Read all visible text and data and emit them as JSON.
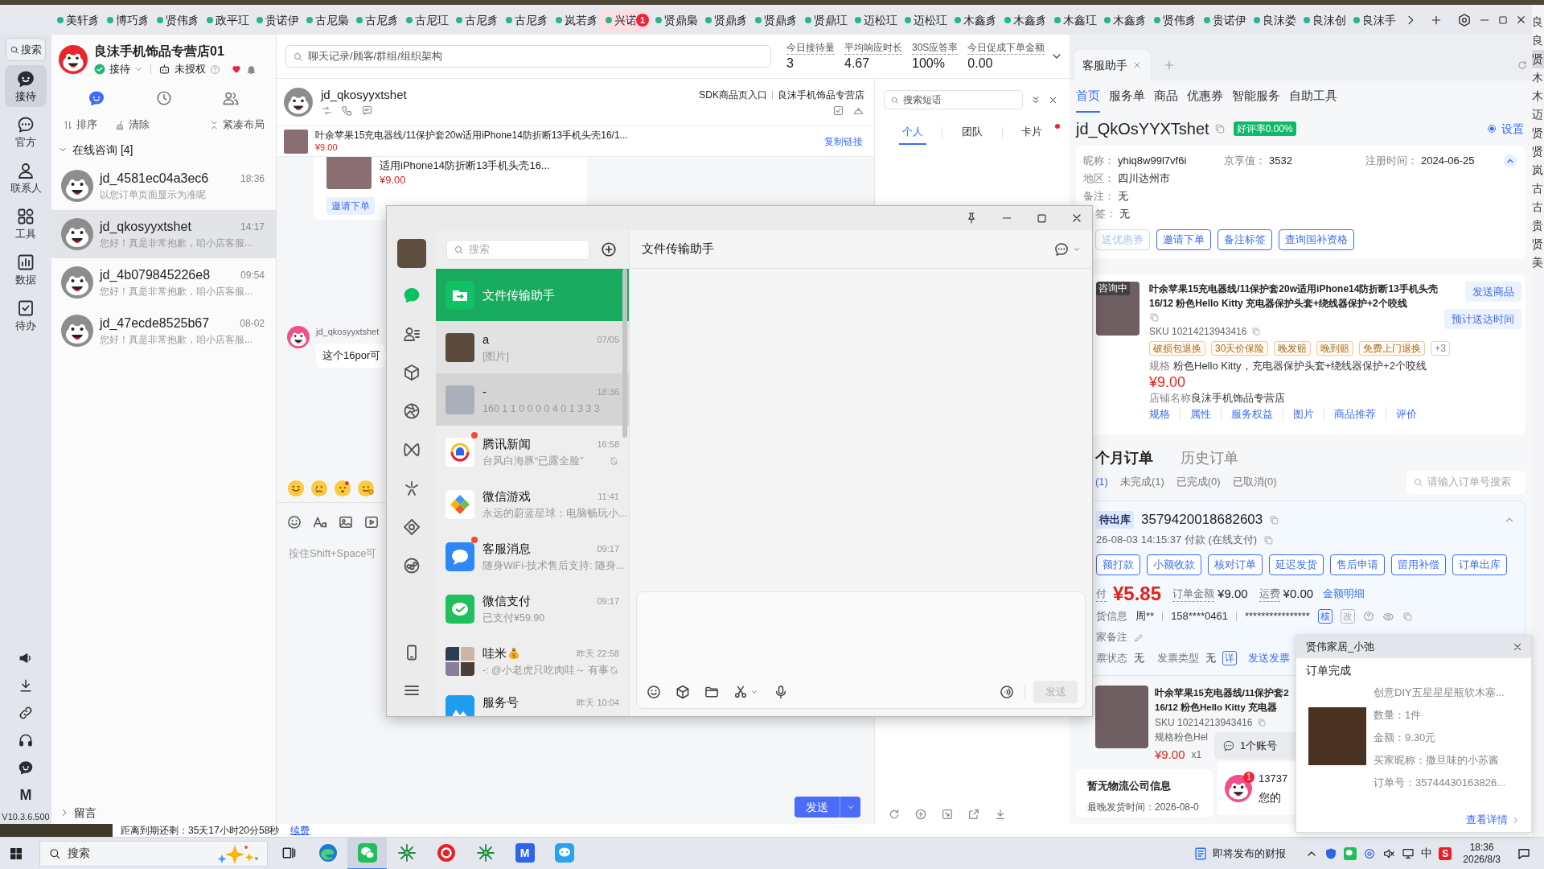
{
  "top_tabs": [
    {
      "label": "美轩豸",
      "selected": false
    },
    {
      "label": "博巧豸",
      "selected": false
    },
    {
      "label": "贤伟豸",
      "selected": false
    },
    {
      "label": "政平玒",
      "selected": false
    },
    {
      "label": "贵诺伊",
      "selected": false
    },
    {
      "label": "古尼梟",
      "selected": false
    },
    {
      "label": "古尼豸",
      "selected": false
    },
    {
      "label": "古尼玒",
      "selected": false
    },
    {
      "label": "古尼豸",
      "selected": false
    },
    {
      "label": "古尼豸",
      "selected": false
    },
    {
      "label": "岚若豸",
      "selected": false
    },
    {
      "label": "兴诺",
      "selected": true,
      "badge": "1"
    },
    {
      "label": "贤鼎梟",
      "selected": false
    },
    {
      "label": "贤鼎豸",
      "selected": false
    },
    {
      "label": "贤鼎豸",
      "selected": false
    },
    {
      "label": "贤鼎玒",
      "selected": false
    },
    {
      "label": "迈松玒",
      "selected": false
    },
    {
      "label": "迈松玒",
      "selected": false
    },
    {
      "label": "木鑫豸",
      "selected": false
    },
    {
      "label": "木鑫豸",
      "selected": false
    },
    {
      "label": "木鑫玒",
      "selected": false
    },
    {
      "label": "木鑫豸",
      "selected": false
    },
    {
      "label": "贤伟豸",
      "selected": false
    },
    {
      "label": "贵诺伊",
      "selected": false
    },
    {
      "label": "良沫娄",
      "selected": false
    },
    {
      "label": "良沫创",
      "selected": false
    },
    {
      "label": "良沫手",
      "selected": false
    }
  ],
  "side_strip": [
    {
      "label": "良",
      "selected": false
    },
    {
      "label": "良",
      "selected": false
    },
    {
      "label": "贤",
      "selected": true
    },
    {
      "label": "木",
      "selected": false
    },
    {
      "label": "木",
      "selected": false
    },
    {
      "label": "迈",
      "selected": false
    },
    {
      "label": "贤",
      "selected": false
    },
    {
      "label": "贤",
      "selected": false
    },
    {
      "label": "岚",
      "selected": false
    },
    {
      "label": "古",
      "selected": false
    },
    {
      "label": "古",
      "selected": false
    },
    {
      "label": "贵",
      "selected": false
    },
    {
      "label": "贤",
      "selected": false
    },
    {
      "label": "美",
      "selected": false
    }
  ],
  "nav": {
    "search": "搜索",
    "items": [
      {
        "label": "接待",
        "selected": true
      },
      {
        "label": "官方",
        "selected": false
      },
      {
        "label": "联系人",
        "selected": false
      },
      {
        "label": "工具",
        "selected": false
      },
      {
        "label": "数据",
        "selected": false
      },
      {
        "label": "待办",
        "selected": false
      }
    ],
    "logo": "M",
    "version": "V10.3.6.500"
  },
  "store": {
    "name": "良沫手机饰品专营店01",
    "status": "接待",
    "auth": "未授权"
  },
  "conversations": {
    "tabs": [
      {
        "selected": true
      },
      {
        "selected": false
      },
      {
        "selected": false
      }
    ],
    "actions": [
      "排序",
      "清除",
      "紧凑布局"
    ],
    "group": "在线咨询 [4]",
    "items": [
      {
        "name": "jd_4581ec04a3ec6",
        "time": "18:36",
        "preview": "以您订单页面显示为准呢",
        "selected": false
      },
      {
        "name": "jd_qkosyyxtshet",
        "time": "14:17",
        "preview": "您好！真是非常抱歉，咱小店客服...",
        "selected": true
      },
      {
        "name": "jd_4b079845226e8",
        "time": "09:54",
        "preview": "您好！真是非常抱歉，咱小店客服...",
        "selected": false
      },
      {
        "name": "jd_47ecde8525b67",
        "time": "08-02",
        "preview": "您好！真是非常抱歉，咱小店客服...",
        "selected": false
      }
    ],
    "footer": "留言"
  },
  "search": {
    "placeholder": "聊天记录/顾客/群组/组织架构"
  },
  "stats": [
    {
      "label": "今日接待量",
      "value": "3"
    },
    {
      "label": "平均响应时长",
      "value": "4.67"
    },
    {
      "label": "30S应答率",
      "value": "100%"
    },
    {
      "label": "今日促成下单金额",
      "value": "0.00"
    }
  ],
  "chat": {
    "customer": "jd_qkosyyxtshet",
    "links": [
      "SDK商品页入口",
      "良沫手机饰品专营店"
    ],
    "product": {
      "title": "叶余苹果15充电器线/11保护套20w适用iPhone14防折断13手机头壳16/1...",
      "price": "¥9.00",
      "action": "复制链接"
    },
    "card": {
      "title": "适用iPhone14防折断13手机头壳16...",
      "price": "¥9.00",
      "button": "邀请下单"
    },
    "message": {
      "sender": "jd_qkosyyxtshet",
      "text": "这个16por可"
    },
    "input": {
      "placeholder": "按住Shift+Space可"
    },
    "send": "发送",
    "expiry": "距离到期还剩：35天17小时20分58秒",
    "renew": "续费"
  },
  "phrases": {
    "placeholder": "搜索短语",
    "tabs": [
      {
        "label": "个人",
        "selected": true,
        "unread": false
      },
      {
        "label": "团队",
        "selected": false,
        "unread": false
      },
      {
        "label": "卡片",
        "selected": false,
        "unread": true
      }
    ]
  },
  "assistant": {
    "tabs": [
      {
        "label": "客服助手",
        "selected": true
      }
    ],
    "nav": [
      {
        "label": "首页",
        "selected": true
      },
      {
        "label": "服务单",
        "selected": false
      },
      {
        "label": "商品",
        "selected": false
      },
      {
        "label": "优惠券",
        "selected": false
      },
      {
        "label": "智能服务",
        "selected": false
      },
      {
        "label": "自助工具",
        "selected": false
      }
    ],
    "customer": "jd_QkOsYYXTshet",
    "rating": "好评率0.00%",
    "settings": "设置",
    "info": [
      {
        "label": "昵称：",
        "value": "yhiq8w99l7vf6i"
      },
      {
        "label": "京享值：",
        "value": "3532"
      },
      {
        "label": "注册时间：",
        "value": "2024-06-25"
      },
      {
        "label": "地区：",
        "value": "四川达州市"
      },
      {
        "label": "备注：",
        "value": "无"
      },
      {
        "label": "签：",
        "value": "无"
      }
    ],
    "actions": [
      {
        "label": "送优惠券",
        "disabled": true
      },
      {
        "label": "邀请下单",
        "disabled": false
      },
      {
        "label": "备注标签",
        "disabled": false
      },
      {
        "label": "查询国补资格",
        "disabled": false
      }
    ],
    "product": {
      "status": "咨询中",
      "title": "叶余苹果15充电器线/11保护套20w适用iPhone14防折断13手机头壳16/12 粉色Hello Kitty 充电器保护头套+绕线器保护+2个咬线",
      "sku": "SKU 10214213943416",
      "tags": [
        "破损包退换",
        "30天价保险",
        "晚发赔",
        "晚到赔",
        "免费上门退换"
      ],
      "more": "+3",
      "spec_label": "规格",
      "spec": "粉色Hello Kitty，充电器保护头套+绕线器保护+2个咬线",
      "price": "¥9.00",
      "store_label": "店铺名称",
      "store": "良沫手机饰品专营店",
      "links": [
        "规格",
        "属性",
        "服务权益",
        "图片",
        "商品推荐",
        "评价"
      ],
      "buttons": [
        "发送商品",
        "预计送达时间"
      ]
    },
    "order_tabs": [
      {
        "label": "个月订单",
        "selected": true
      },
      {
        "label": "历史订单",
        "selected": false
      }
    ],
    "filters": [
      {
        "label": "(1)",
        "selected": true
      },
      {
        "label": "未完成(1)",
        "selected": false
      },
      {
        "label": "已完成(0)",
        "selected": false
      },
      {
        "label": "已取消(0)",
        "selected": false
      }
    ],
    "order_search": "请输入订单号搜索",
    "order": {
      "status": "待出库",
      "number": "3579420018682603",
      "paid": "26-08-03 14:15:37 付款 (在线支付)",
      "actions": [
        "额打款",
        "小额收款",
        "核对订单",
        "延迟发货",
        "售后申请",
        "留用补偿",
        "订单出库"
      ],
      "total_label": "付",
      "total": "¥5.85",
      "amount_label": "订单金额",
      "amount": "¥9.00",
      "freight_label": "运费",
      "freight": "¥0.00",
      "detail": "金额明细",
      "receiver_label": "货信息",
      "receiver": [
        "周**",
        "158****0461",
        "****************"
      ],
      "verify": "核",
      "edit": "改",
      "remark_label": "家备注",
      "invoice_label": "票状态",
      "invoice_status": "无",
      "invoice_type_label": "发票类型",
      "invoice_type": "无",
      "invoice_detail": "详",
      "send_invoice": "发送发票"
    },
    "item": {
      "title": "叶余苹果15充电器线/11保护套2",
      "subtitle": "16/12 粉色Hello Kitty 充电器",
      "sku": "SKU 10214213943416",
      "spec": "规格粉色Hel",
      "price": "¥9.00",
      "qty": "x1"
    },
    "logistics": {
      "title": "暂无物流公司信息",
      "deadline": "最晚发货时间：2026-08-0"
    }
  },
  "wechat": {
    "nav": [
      {
        "selected": true
      },
      {
        "selected": false
      },
      {
        "selected": false
      },
      {
        "selected": false
      },
      {
        "selected": false
      },
      {
        "selected": false
      },
      {
        "selected": false
      },
      {
        "selected": false
      }
    ],
    "search": "搜索",
    "title": "文件传输助手",
    "chats": [
      {
        "kind": "file",
        "name": "文件传输助手",
        "selected": true,
        "pinned": true,
        "hovered": false,
        "unread": false,
        "muted": false
      },
      {
        "kind": "photo",
        "name": "a",
        "time": "07/05",
        "preview": "[图片]",
        "selected": false,
        "pinned": true,
        "hovered": false,
        "unread": false,
        "muted": false
      },
      {
        "kind": "picture",
        "name": "-",
        "time": "18:36",
        "preview": "160 1 1 0 0 0 0 4 0 1 3 3 3",
        "selected": false,
        "pinned": true,
        "hovered": true,
        "unread": false,
        "muted": false
      },
      {
        "kind": "news",
        "name": "腾讯新闻",
        "time": "16:58",
        "preview": "台风白海豚“已露全脸”",
        "selected": false,
        "pinned": false,
        "hovered": false,
        "unread": true,
        "muted": true
      },
      {
        "kind": "games",
        "name": "微信游戏",
        "time": "11:41",
        "preview": "永远的蔚蓝星球：电脑畅玩小...",
        "selected": false,
        "pinned": false,
        "hovered": false,
        "unread": false,
        "muted": false
      },
      {
        "kind": "service",
        "name": "客服消息",
        "time": "09:17",
        "preview": "随身WiFi-技术售后支持: 随身...",
        "selected": false,
        "pinned": false,
        "hovered": false,
        "unread": true,
        "muted": false
      },
      {
        "kind": "pay",
        "name": "微信支付",
        "time": "09:17",
        "preview": "已支付¥59.90",
        "selected": false,
        "pinned": false,
        "hovered": false,
        "unread": false,
        "muted": false
      },
      {
        "kind": "group",
        "name": "哇米",
        "time": "昨天 22:58",
        "preview": "-: @小老虎只吃肉哇～ 有事",
        "selected": false,
        "pinned": false,
        "hovered": false,
        "unread": false,
        "muted": true
      },
      {
        "kind": "official",
        "name": "服务号",
        "time": "昨天 10:04",
        "selected": false,
        "pinned": false,
        "hovered": false,
        "unread": false,
        "muted": false
      }
    ],
    "send": {
      "label": "发送",
      "disabled": true
    }
  },
  "popups": {
    "account": "1个账号",
    "message": {
      "badge": "1",
      "title": "13737",
      "text": "您的"
    },
    "notification": {
      "title": "贤伟家居_小弛",
      "heading": "订单完成",
      "product": "创意DIY五星星星瓶软木塞...",
      "lines": [
        "数量：1件",
        "金额：9.30元",
        "买家昵称：撒旦味的小苏酱",
        "订单号：35744430163826..."
      ],
      "link": "查看详情"
    }
  },
  "taskbar": {
    "search": "搜索",
    "apps": [
      {
        "kind": "task_view",
        "active": false
      },
      {
        "kind": "browser",
        "active": false
      },
      {
        "kind": "wechat",
        "active": true
      },
      {
        "kind": "star",
        "active": false
      },
      {
        "kind": "ring",
        "active": false
      },
      {
        "kind": "star",
        "active": false
      },
      {
        "kind": "letter",
        "label": "M",
        "active": false
      },
      {
        "kind": "chat",
        "active": false
      }
    ],
    "news": "即将发布的财报",
    "ime": "中",
    "ime_logo": "S",
    "time": "18:36",
    "date": "2026/8/3"
  }
}
